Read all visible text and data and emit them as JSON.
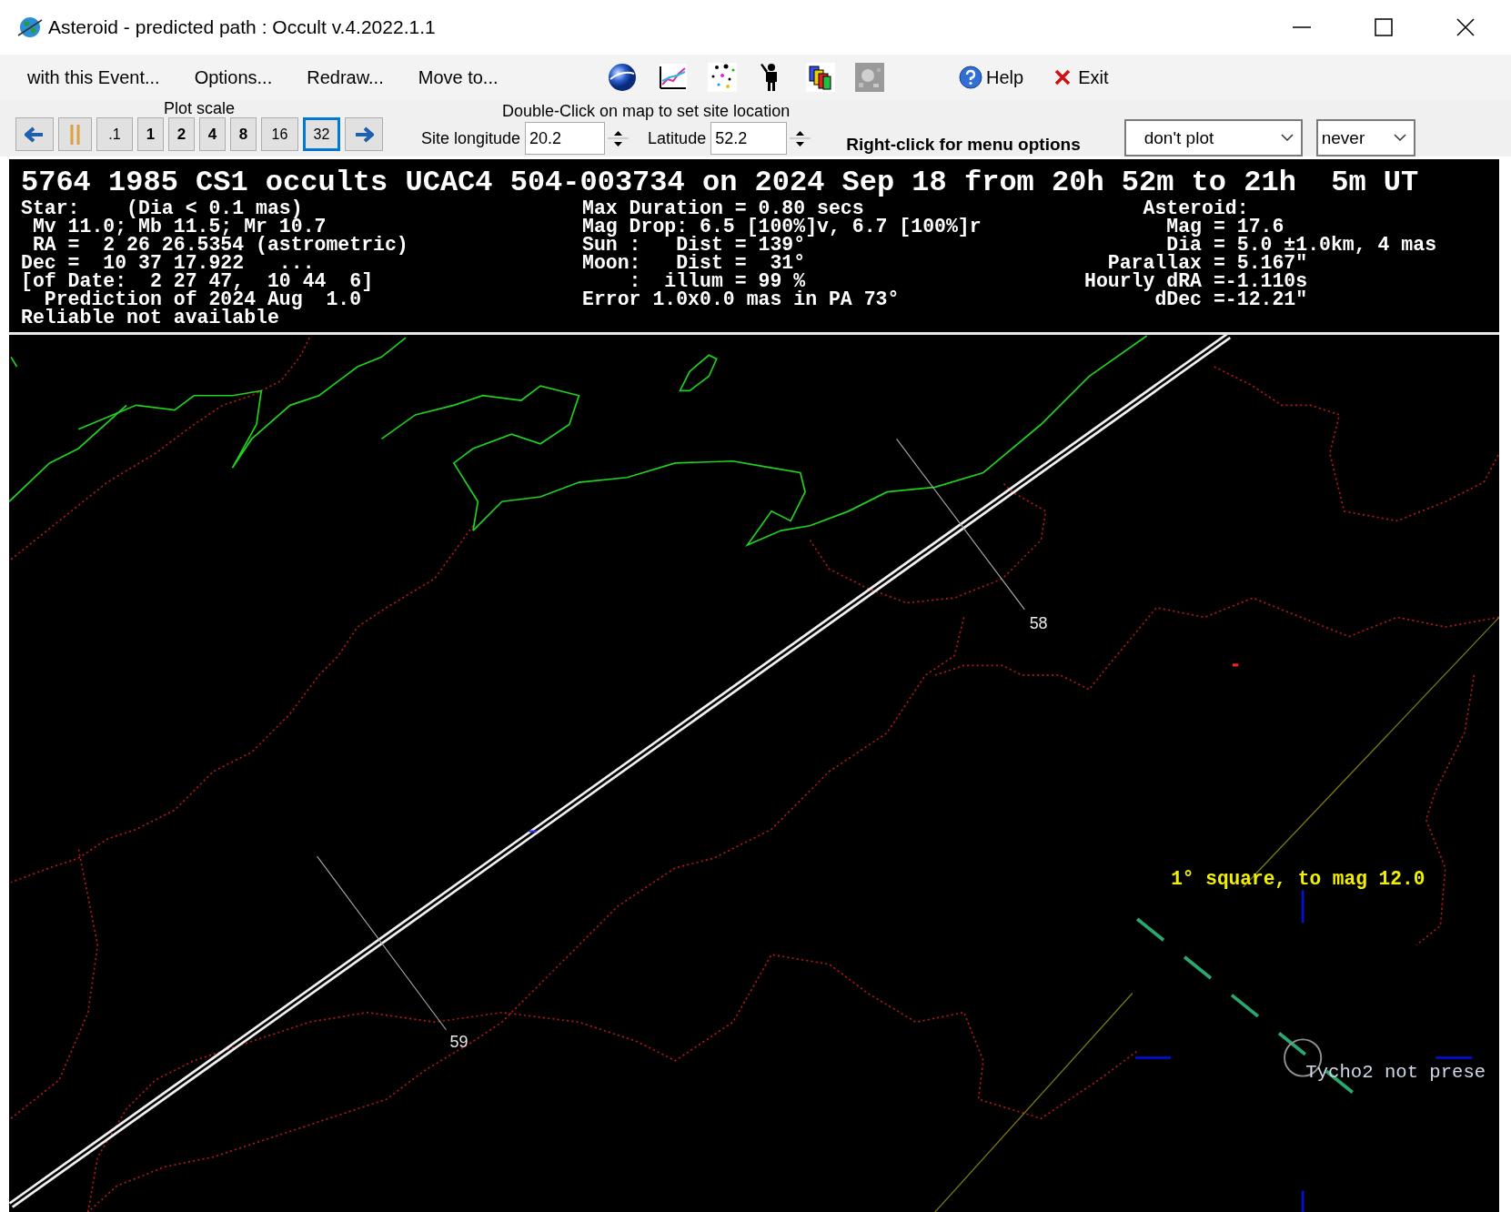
{
  "window": {
    "title": "Asteroid - predicted path : Occult v.4.2022.1.1"
  },
  "menu": {
    "items": [
      "with this Event...",
      "Options...",
      "Redraw...",
      "Move to..."
    ],
    "help": "Help",
    "exit": "Exit"
  },
  "plot_scale": {
    "label": "Plot scale",
    "buttons": [
      {
        "label": ".1",
        "selected": false
      },
      {
        "label": "1",
        "selected": false
      },
      {
        "label": "2",
        "selected": false
      },
      {
        "label": "4",
        "selected": false
      },
      {
        "label": "8",
        "selected": false
      },
      {
        "label": "16",
        "selected": false
      },
      {
        "label": "32",
        "selected": true
      }
    ]
  },
  "site": {
    "hint": "Double-Click on map to set site location",
    "longitude_label": "Site longitude",
    "longitude": "20.2",
    "latitude_label": "Latitude",
    "latitude": "52.2"
  },
  "right_click_hint": "Right-click for menu options",
  "dropdowns": [
    {
      "value": "don't plot"
    },
    {
      "value": "never"
    }
  ],
  "event": {
    "heading": "5764 1985 CS1 occults UCAC4 504-003734 on 2024 Sep 18 from 20h 52m to 21h  5m UT",
    "star_lines": [
      "Star:    (Dia < 0.1 mas)",
      " Mv 11.0; Mb 11.5; Mr 10.7",
      " RA =  2 26 26.5354 (astrometric)",
      "Dec =  10 37 17.922   ...",
      "[of Date:  2 27 47,  10 44  6]",
      "  Prediction of 2024 Aug  1.0",
      "Reliable not available"
    ],
    "event_lines": [
      "Max Duration = 0.80 secs",
      "Mag Drop: 6.5 [100%]v, 6.7 [100%]r",
      "Sun :   Dist = 139°",
      "Moon:   Dist =  31°",
      "    :  illum = 99 %",
      "Error 1.0x0.0 mas in PA 73°"
    ],
    "asteroid_lines": [
      "     Asteroid:",
      "       Mag = 17.6",
      "       Dia = 5.0 ±1.0km, 4 mas",
      "  Parallax = 5.167\"",
      "Hourly dRA =-1.110s",
      "      dDec =-12.21\""
    ]
  },
  "map": {
    "track_labels": [
      "58",
      "59"
    ],
    "star_field_note": "1° square, to mag 12.0",
    "catalog_note": "Tycho2 not prese"
  }
}
